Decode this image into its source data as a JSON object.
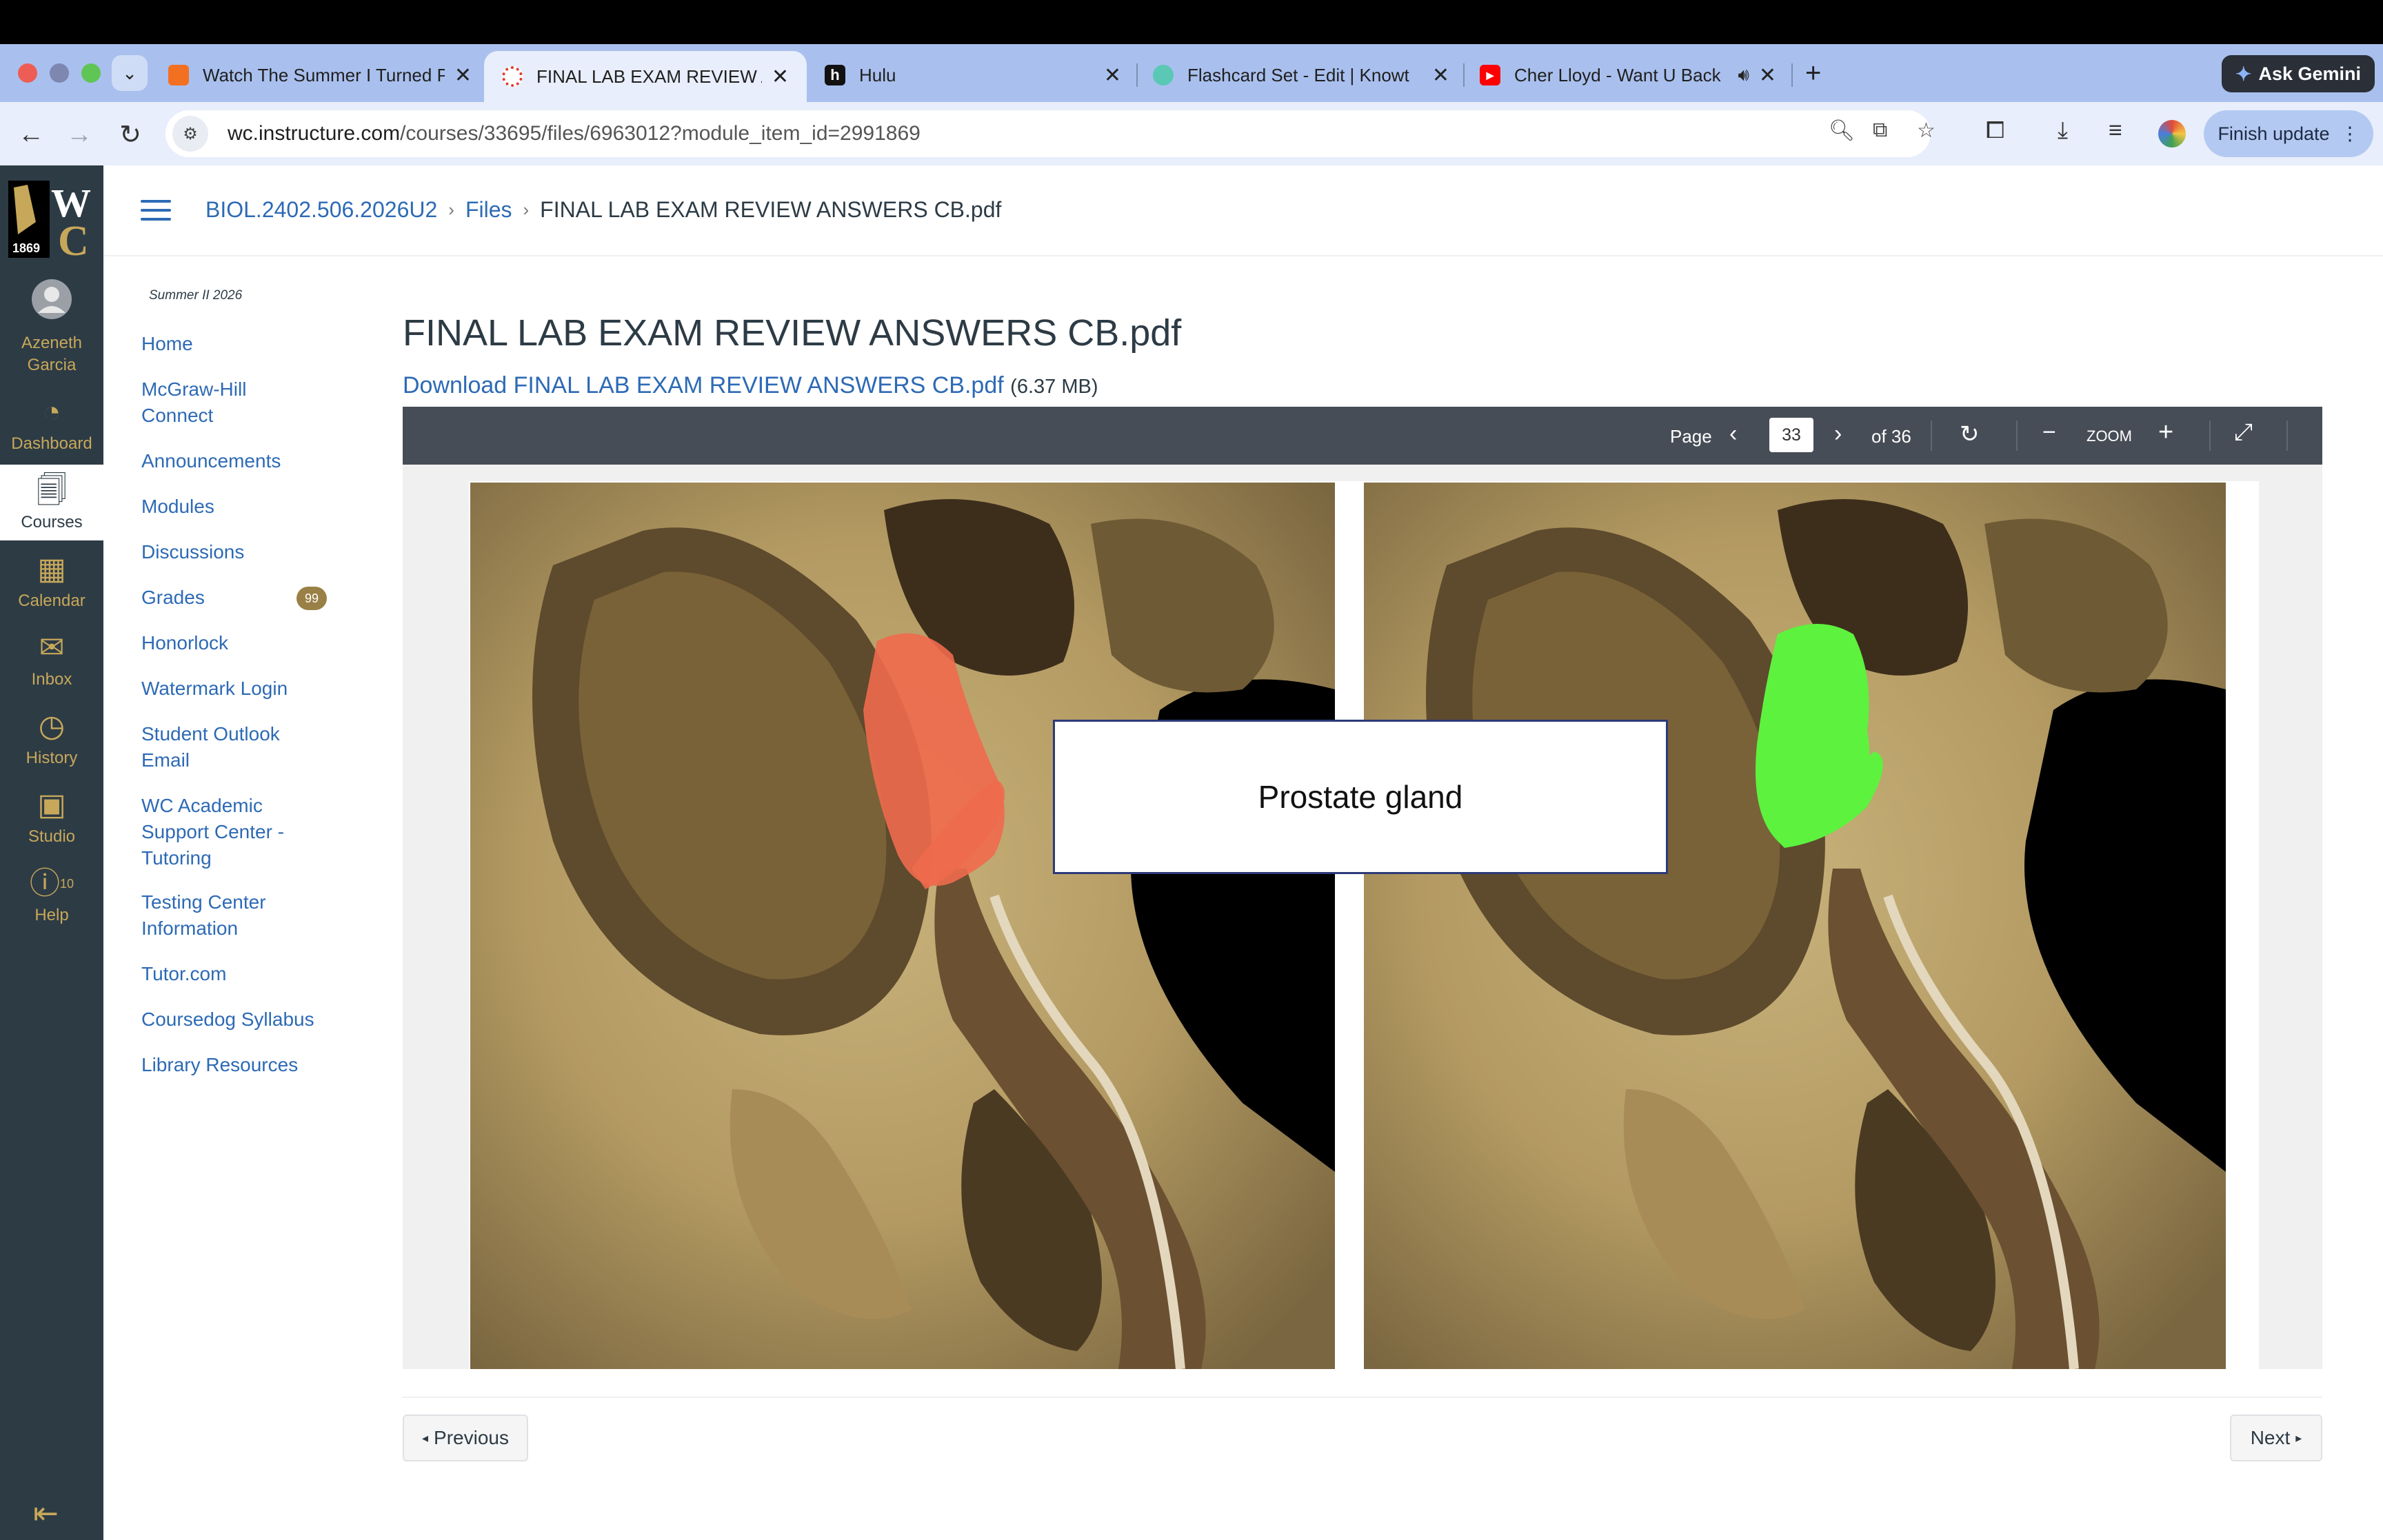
{
  "browser": {
    "tabs": [
      {
        "title": "Watch The Summer I Turned P",
        "favicon_color": "#f37021",
        "active": false
      },
      {
        "title": "FINAL LAB EXAM REVIEW AN",
        "favicon_color": "#e03e2d",
        "active": true
      },
      {
        "title": "Hulu",
        "favicon_color": "#111111",
        "favicon_glyph": "h",
        "active": false
      },
      {
        "title": "Flashcard Set - Edit | Knowt",
        "favicon_color": "#5ac8b5",
        "active": false
      },
      {
        "title": "Cher Lloyd - Want U Back",
        "favicon_color": "#ff0000",
        "active": false
      }
    ],
    "new_tab_icon": "plus-icon",
    "ask_gemini_label": "Ask Gemini",
    "url_host": "wc.instructure.com",
    "url_path": "/courses/33695/files/6963012?module_item_id=2991869",
    "finish_update_label": "Finish update"
  },
  "global_nav": {
    "logo_year": "1869",
    "items": [
      {
        "label": "Azeneth Garcia",
        "icon": "account-icon"
      },
      {
        "label": "Dashboard",
        "icon": "dashboard-icon"
      },
      {
        "label": "Courses",
        "icon": "courses-icon",
        "active": true
      },
      {
        "label": "Calendar",
        "icon": "calendar-icon"
      },
      {
        "label": "Inbox",
        "icon": "inbox-icon"
      },
      {
        "label": "History",
        "icon": "history-icon"
      },
      {
        "label": "Studio",
        "icon": "studio-icon"
      },
      {
        "label": "Help",
        "icon": "help-icon",
        "badge": "10"
      }
    ]
  },
  "breadcrumb": {
    "course": "BIOL.2402.506.2026U2",
    "section": "Files",
    "current": "FINAL LAB EXAM REVIEW ANSWERS CB.pdf"
  },
  "course_nav": {
    "term": "Summer II 2026",
    "items": [
      "Home",
      "McGraw-Hill Connect",
      "Announcements",
      "Modules",
      "Discussions",
      "Grades",
      "Honorlock",
      "Watermark Login",
      "Student Outlook Email",
      "WC Academic Support Center - Tutoring",
      "Testing Center Information",
      "Tutor.com",
      "Coursedog Syllabus",
      "Library Resources"
    ],
    "grades_badge": "99"
  },
  "file": {
    "title": "FINAL LAB EXAM REVIEW ANSWERS CB.pdf",
    "download_label": "Download FINAL LAB EXAM REVIEW ANSWERS CB.pdf",
    "size": "(6.37 MB)"
  },
  "viewer": {
    "page_label": "Page",
    "current_page": "33",
    "of_label": "of 36",
    "zoom_label": "ZOOM"
  },
  "slide": {
    "answer_label": "Prostate gland",
    "left_highlight_color": "#f06a4e",
    "right_highlight_color": "#5df23e"
  },
  "pager": {
    "previous_label": "Previous",
    "next_label": "Next"
  }
}
